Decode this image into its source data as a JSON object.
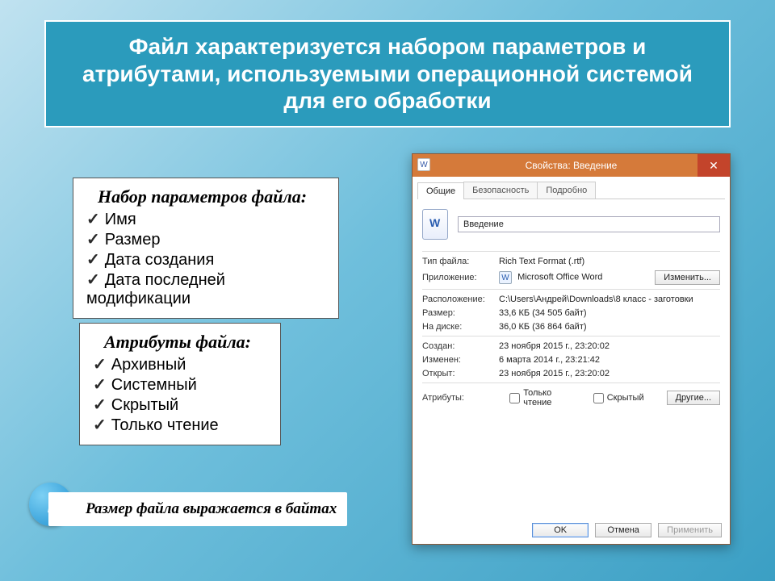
{
  "title": "Файл характеризуется набором параметров и атрибутами, используемыми операционной системой для его обработки",
  "params_card": {
    "title": "Набор параметров файла:",
    "items": [
      "Имя",
      "Размер",
      "Дата создания",
      "Дата последней модификации"
    ]
  },
  "attrs_card": {
    "title": "Атрибуты файла:",
    "items": [
      "Архивный",
      "Системный",
      "Скрытый",
      "Только чтение"
    ]
  },
  "info_note": "Размер файла выражается в байтах",
  "dialog": {
    "window_title": "Свойства: Введение",
    "close_glyph": "✕",
    "tabs": {
      "general": "Общие",
      "security": "Безопасность",
      "details": "Подробно"
    },
    "filename": "Введение",
    "labels": {
      "type": "Тип файла:",
      "app": "Приложение:",
      "location": "Расположение:",
      "size": "Размер:",
      "disk": "На диске:",
      "created": "Создан:",
      "modified": "Изменен:",
      "opened": "Открыт:",
      "attrs": "Атрибуты:"
    },
    "values": {
      "type": "Rich Text Format (.rtf)",
      "app": "Microsoft Office Word",
      "location": "C:\\Users\\Андрей\\Downloads\\8 класс - заготовки",
      "size": "33,6 КБ (34 505 байт)",
      "disk": "36,0 КБ (36 864 байт)",
      "created": "23 ноября 2015 г., 23:20:02",
      "modified": "6 марта 2014 г., 23:21:42",
      "opened": "23 ноября 2015 г., 23:20:02"
    },
    "change_btn": "Изменить...",
    "attr_readonly": "Только чтение",
    "attr_hidden": "Скрытый",
    "other_btn": "Другие...",
    "buttons": {
      "ok": "OK",
      "cancel": "Отмена",
      "apply": "Применить"
    }
  }
}
